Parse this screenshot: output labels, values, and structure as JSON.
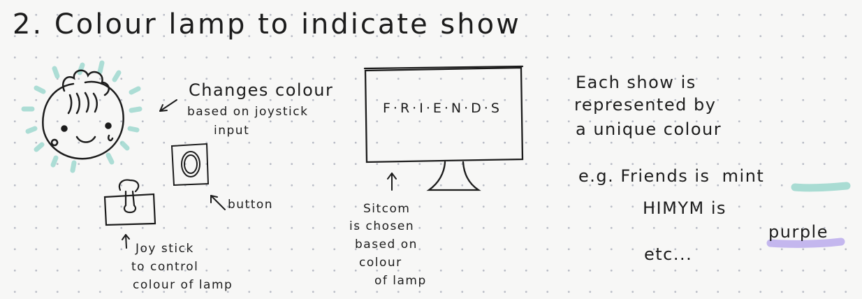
{
  "title": "2. Colour lamp to indicate show",
  "lamp_note": [
    "Changes colour",
    "based on joystick",
    "input"
  ],
  "button_label": "button",
  "joystick_note": [
    "Joy stick",
    "to control",
    "colour of lamp"
  ],
  "tv_screen_text": "F·R·I·E·N·D·S",
  "sitcom_note": [
    "Sitcom",
    "is chosen",
    "based on",
    "colour",
    "of lamp"
  ],
  "description": [
    "Each show is",
    "represented by",
    "a unique colour"
  ],
  "example": {
    "line1_prefix": "e.g. Friends is",
    "line1_color_word": "mint",
    "line2_prefix": "HIMYM is",
    "line2_color_word": "purple",
    "line3": "etc..."
  },
  "colors": {
    "mint_glow": "#9fd9d0",
    "mint_highlight": "#a9dcd3",
    "purple_highlight": "#c4b7ee",
    "ink": "#1c1c1c"
  }
}
